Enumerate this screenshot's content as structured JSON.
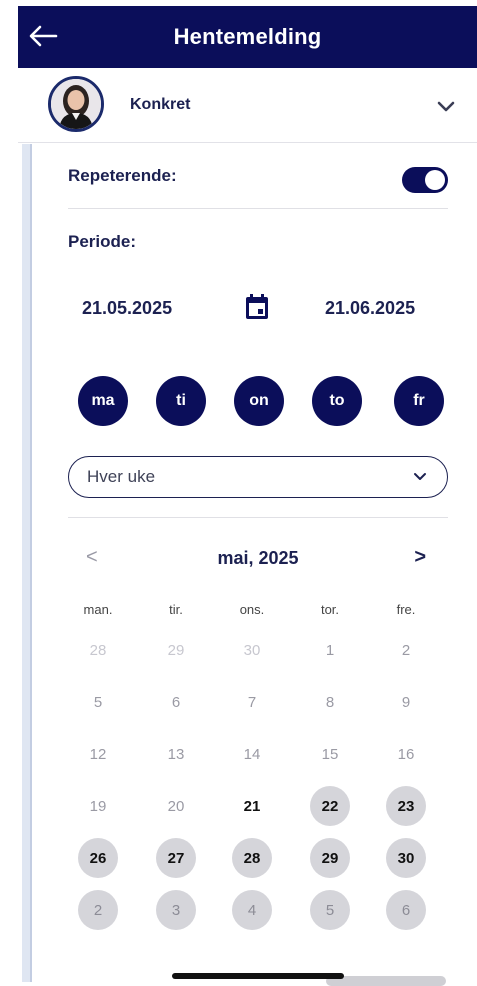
{
  "header": {
    "title": "Hentemelding",
    "back": "back-arrow-icon"
  },
  "child": {
    "name": "Konkret"
  },
  "repeat": {
    "label": "Repeterende:",
    "enabled": true
  },
  "period": {
    "label": "Periode:",
    "from": "21.05.2025",
    "to": "21.06.2025"
  },
  "weekday_buttons": [
    "ma",
    "ti",
    "on",
    "to",
    "fr"
  ],
  "frequency": {
    "selected": "Hver uke"
  },
  "calendar": {
    "month_label": "mai, 2025",
    "prev": "<",
    "next": ">",
    "weekdays": [
      "man.",
      "tir.",
      "ons.",
      "tor.",
      "fre."
    ],
    "weeks": [
      [
        {
          "d": "28",
          "s": "faint"
        },
        {
          "d": "29",
          "s": "faint"
        },
        {
          "d": "30",
          "s": "faint"
        },
        {
          "d": "1",
          "s": "muted"
        },
        {
          "d": "2",
          "s": "muted"
        }
      ],
      [
        {
          "d": "5",
          "s": "muted"
        },
        {
          "d": "6",
          "s": "muted"
        },
        {
          "d": "7",
          "s": "muted"
        },
        {
          "d": "8",
          "s": "muted"
        },
        {
          "d": "9",
          "s": "muted"
        }
      ],
      [
        {
          "d": "12",
          "s": "muted"
        },
        {
          "d": "13",
          "s": "muted"
        },
        {
          "d": "14",
          "s": "muted"
        },
        {
          "d": "15",
          "s": "muted"
        },
        {
          "d": "16",
          "s": "muted"
        }
      ],
      [
        {
          "d": "19",
          "s": "muted"
        },
        {
          "d": "20",
          "s": "muted"
        },
        {
          "d": "21",
          "s": "today"
        },
        {
          "d": "22",
          "s": "sel"
        },
        {
          "d": "23",
          "s": "sel"
        }
      ],
      [
        {
          "d": "26",
          "s": "sel"
        },
        {
          "d": "27",
          "s": "sel"
        },
        {
          "d": "28",
          "s": "sel"
        },
        {
          "d": "29",
          "s": "sel"
        },
        {
          "d": "30",
          "s": "sel"
        }
      ],
      [
        {
          "d": "2",
          "s": "next"
        },
        {
          "d": "3",
          "s": "next"
        },
        {
          "d": "4",
          "s": "next"
        },
        {
          "d": "5",
          "s": "next"
        },
        {
          "d": "6",
          "s": "next"
        }
      ]
    ]
  },
  "colors": {
    "primary": "#0b0e5a",
    "text": "#1c2151",
    "selected_bg": "#d5d5da"
  }
}
